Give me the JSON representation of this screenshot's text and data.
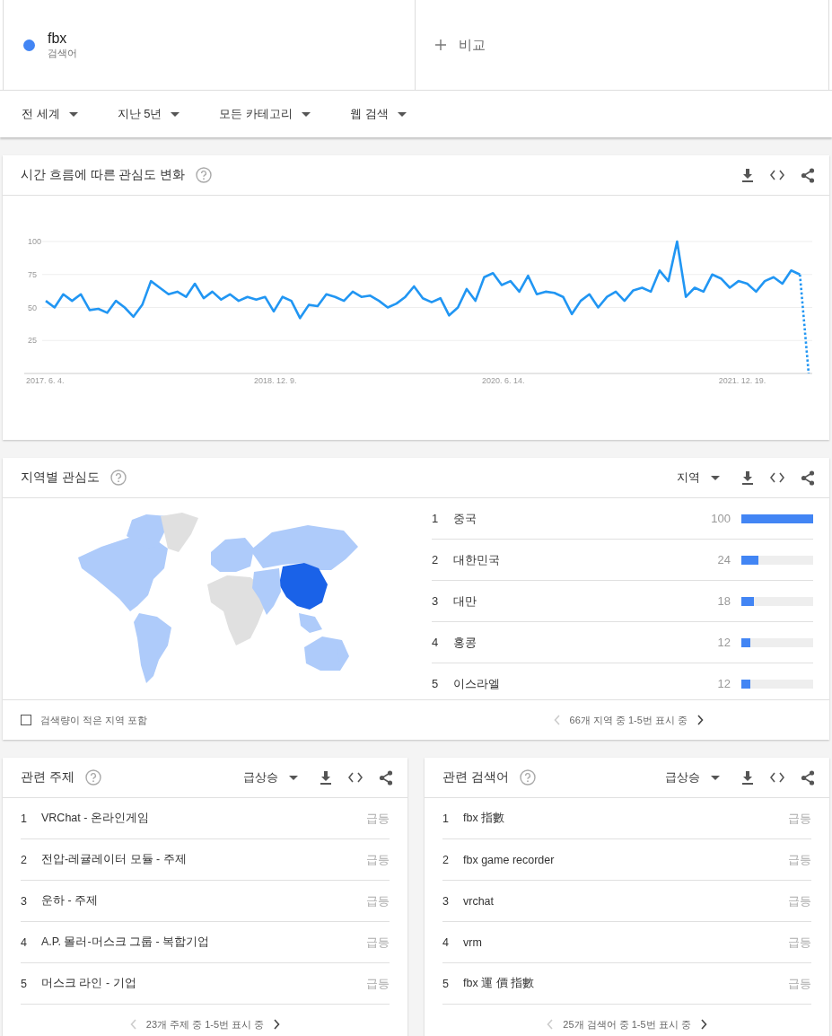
{
  "search_terms": [
    {
      "term": "fbx",
      "label": "검색어",
      "color": "#4285f4"
    }
  ],
  "compare": {
    "label": "비교"
  },
  "filters": [
    {
      "label": "전 세계"
    },
    {
      "label": "지난 5년"
    },
    {
      "label": "모든 카테고리"
    },
    {
      "label": "웹 검색"
    }
  ],
  "interest_over_time": {
    "title": "시간 흐름에 따른 관심도 변화",
    "chart_data": {
      "type": "line",
      "categories": [
        "2017. 6. 4.",
        null,
        null,
        null,
        null,
        null,
        null,
        null,
        null,
        null,
        null,
        null,
        null,
        null,
        null,
        null,
        null,
        null,
        null,
        null,
        null,
        null,
        null,
        null,
        null,
        null,
        "2018. 12. 9.",
        null,
        null,
        null,
        null,
        null,
        null,
        null,
        null,
        null,
        null,
        null,
        null,
        null,
        null,
        null,
        null,
        null,
        null,
        null,
        null,
        null,
        null,
        null,
        null,
        null,
        "2020. 6. 14.",
        null,
        null,
        null,
        null,
        null,
        null,
        null,
        null,
        null,
        null,
        null,
        null,
        null,
        null,
        null,
        null,
        null,
        null,
        null,
        null,
        null,
        null,
        null,
        null,
        null,
        null,
        "2021. 12. 19.",
        null,
        null,
        null,
        null,
        null,
        null,
        null,
        null
      ],
      "series": [
        {
          "color": "#2196f3",
          "values": [
            55,
            50,
            60,
            55,
            60,
            48,
            49,
            46,
            55,
            50,
            43,
            52,
            70,
            65,
            60,
            62,
            58,
            68,
            57,
            62,
            56,
            60,
            55,
            58,
            56,
            58,
            47,
            58,
            55,
            42,
            52,
            51,
            60,
            58,
            55,
            62,
            58,
            59,
            55,
            50,
            53,
            58,
            66,
            57,
            54,
            57,
            44,
            50,
            64,
            55,
            73,
            76,
            67,
            70,
            62,
            74,
            60,
            62,
            61,
            58,
            45,
            55,
            60,
            50,
            58,
            62,
            55,
            63,
            65,
            62,
            78,
            70,
            100,
            58,
            65,
            62,
            75,
            72,
            65,
            70,
            68,
            62,
            70,
            73,
            68,
            78,
            75,
            0
          ]
        }
      ],
      "ylim": [
        0,
        100
      ],
      "yticks": [
        25,
        50,
        75,
        100
      ],
      "grid": true
    }
  },
  "interest_by_region": {
    "title": "지역별 관심도",
    "dropdown": "지역",
    "rows": [
      {
        "rank": "1",
        "name": "중국",
        "value": "100",
        "level": 1.0
      },
      {
        "rank": "2",
        "name": "대한민국",
        "value": "24",
        "level": 0.24
      },
      {
        "rank": "3",
        "name": "대만",
        "value": "18",
        "level": 0.18
      },
      {
        "rank": "4",
        "name": "홍콩",
        "value": "12",
        "level": 0.12
      },
      {
        "rank": "5",
        "name": "이스라엘",
        "value": "12",
        "level": 0.12
      }
    ],
    "checkbox": {
      "label": "검색량이 적은 지역 포함",
      "checked": false
    },
    "pagination": {
      "text": "66개 지역 중 1-5번 표시 중",
      "prev_disabled": true,
      "next_disabled": false
    }
  },
  "related_topics": {
    "title": "관련 주제",
    "dropdown": "급상승",
    "rows": [
      {
        "rank": "1",
        "name": "VRChat - 온라인게임",
        "value": "급등"
      },
      {
        "rank": "2",
        "name": "전압-레귤레이터 모듈 - 주제",
        "value": "급등"
      },
      {
        "rank": "3",
        "name": "운하 - 주제",
        "value": "급등"
      },
      {
        "rank": "4",
        "name": "A.P. 몰러-머스크 그룹 - 복합기업",
        "value": "급등"
      },
      {
        "rank": "5",
        "name": "머스크 라인 - 기업",
        "value": "급등"
      }
    ],
    "pagination": {
      "text": "23개 주제 중 1-5번 표시 중",
      "prev_disabled": true,
      "next_disabled": false
    }
  },
  "related_queries": {
    "title": "관련 검색어",
    "dropdown": "급상승",
    "rows": [
      {
        "rank": "1",
        "name": "fbx 指數",
        "value": "급등"
      },
      {
        "rank": "2",
        "name": "fbx game recorder",
        "value": "급등"
      },
      {
        "rank": "3",
        "name": "vrchat",
        "value": "급등"
      },
      {
        "rank": "4",
        "name": "vrm",
        "value": "급등"
      },
      {
        "rank": "5",
        "name": "fbx 運 價 指數",
        "value": "급등"
      }
    ],
    "pagination": {
      "text": "25개 검색어 중 1-5번 표시 중",
      "prev_disabled": true,
      "next_disabled": false
    }
  }
}
